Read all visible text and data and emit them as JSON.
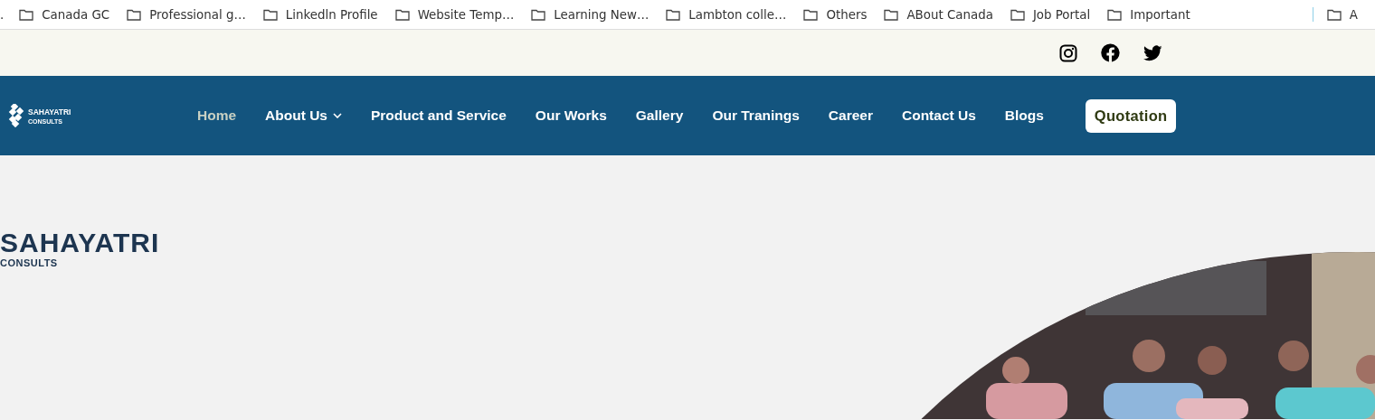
{
  "bookmarks_bar": {
    "leading_text": ".",
    "items": [
      {
        "label": "Canada GC"
      },
      {
        "label": "Professional g…"
      },
      {
        "label": "Linkedln Profile"
      },
      {
        "label": "Website Temp…"
      },
      {
        "label": "Learning New…"
      },
      {
        "label": "Lambton colle…"
      },
      {
        "label": "Others"
      },
      {
        "label": "ABout Canada"
      },
      {
        "label": "Job Portal"
      },
      {
        "label": "Important"
      }
    ],
    "overflow_item": {
      "label": "A"
    }
  },
  "social_links": [
    {
      "kind": "instagram"
    },
    {
      "kind": "facebook"
    },
    {
      "kind": "twitter"
    }
  ],
  "nav": {
    "logo": {
      "name": "SAHAYATRI",
      "tagline": "CONSULTS"
    },
    "items": [
      {
        "label": "Home",
        "selected": true,
        "has_dropdown": false
      },
      {
        "label": "About Us",
        "selected": false,
        "has_dropdown": true
      },
      {
        "label": "Product and Service",
        "selected": false,
        "has_dropdown": false
      },
      {
        "label": "Our Works",
        "selected": false,
        "has_dropdown": false
      },
      {
        "label": "Gallery",
        "selected": false,
        "has_dropdown": false
      },
      {
        "label": "Our Tranings",
        "selected": false,
        "has_dropdown": false
      },
      {
        "label": "Career",
        "selected": false,
        "has_dropdown": false
      },
      {
        "label": "Contact Us",
        "selected": false,
        "has_dropdown": false
      },
      {
        "label": "Blogs",
        "selected": false,
        "has_dropdown": false
      }
    ],
    "cta": "Quotation"
  },
  "hero": {
    "logo": {
      "name": "SAHAYATRI",
      "tagline": "CONSULTS"
    }
  }
}
